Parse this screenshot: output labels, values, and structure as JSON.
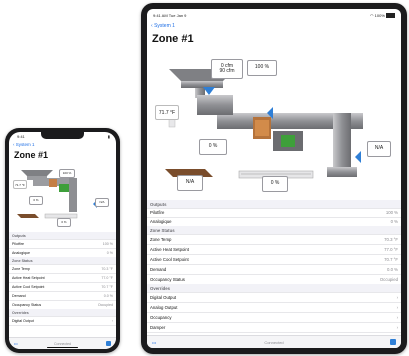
{
  "ipad": {
    "time": "9:41 AM",
    "date": "Tue Jan 9",
    "battery": "100%",
    "back_label": "System 1",
    "title": "Zone #1",
    "readouts": {
      "airflow_actual": "0 cfm",
      "airflow_setpoint": "90 cfm",
      "damper": "100 %",
      "zone_temp": "71.7 °F",
      "heat": "0 %",
      "outside": "N/A",
      "reheat": "N/A",
      "baseboard": "0 %"
    },
    "sections": [
      {
        "header": "Outputs",
        "rows": [
          {
            "label": "Pilotfire",
            "value": "100 %"
          },
          {
            "label": "Analogique",
            "value": "0 %"
          }
        ]
      },
      {
        "header": "Zone Status",
        "rows": [
          {
            "label": "Zone Temp",
            "value": "70.3 °F"
          },
          {
            "label": "Active Heat Setpoint",
            "value": "77.0 °F"
          },
          {
            "label": "Active Cool Setpoint",
            "value": "70.7 °F"
          },
          {
            "label": "Demand",
            "value": "0.0 %"
          },
          {
            "label": "Occupancy Status",
            "value": "Occupied"
          }
        ]
      },
      {
        "header": "Overrides",
        "rows": [
          {
            "label": "Digital Output",
            "value": ""
          },
          {
            "label": "Analog Output",
            "value": ""
          },
          {
            "label": "Occupancy",
            "value": ""
          },
          {
            "label": "Damper",
            "value": ""
          }
        ]
      }
    ],
    "tabbar": {
      "more": "•••",
      "center": "Connected"
    }
  },
  "iphone": {
    "time": "9:41",
    "back_label": "System 1",
    "title": "Zone #1",
    "readouts": {
      "zone_temp": "71.7 °F",
      "damper": "100 %",
      "heat": "0 %",
      "outside": "N/A",
      "baseboard": "0 %"
    },
    "sections": [
      {
        "header": "Outputs",
        "rows": [
          {
            "label": "Pilotfire",
            "value": "100 %"
          },
          {
            "label": "Analogique",
            "value": "0 %"
          }
        ]
      },
      {
        "header": "Zone Status",
        "rows": [
          {
            "label": "Zone Temp",
            "value": "70.3 °F"
          },
          {
            "label": "Active Heat Setpoint",
            "value": "77.0 °F"
          },
          {
            "label": "Active Cool Setpoint",
            "value": "70.7 °F"
          },
          {
            "label": "Demand",
            "value": "0.0 %"
          },
          {
            "label": "Occupancy Status",
            "value": "Occupied"
          }
        ]
      },
      {
        "header": "Overrides",
        "rows": [
          {
            "label": "Digital Output",
            "value": ""
          }
        ]
      }
    ],
    "tabbar": {
      "more": "•••",
      "center": "Connected"
    }
  }
}
